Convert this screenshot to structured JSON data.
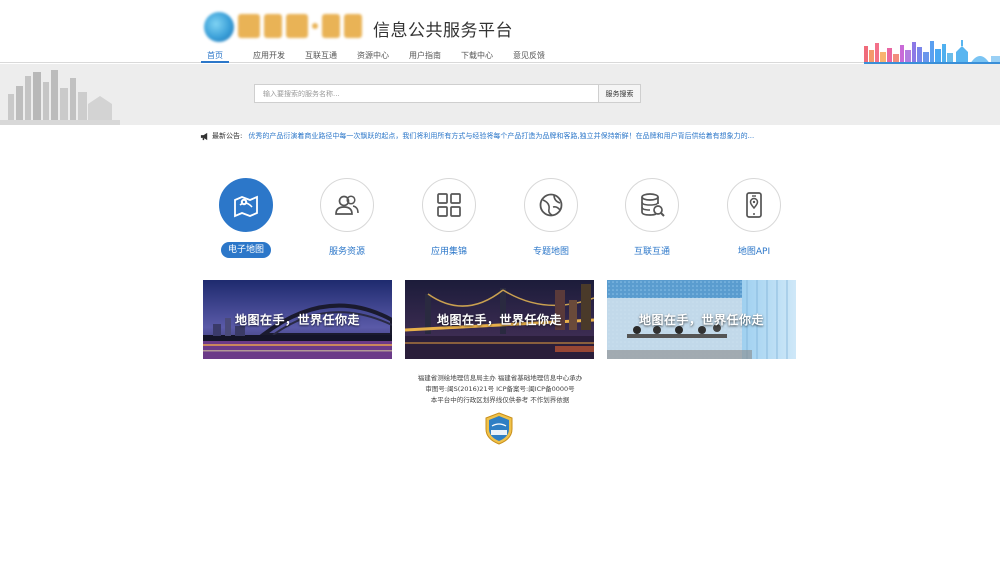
{
  "header": {
    "site_title": "信息公共服务平台",
    "nav": [
      {
        "label": "首页",
        "active": true
      },
      {
        "label": "应用开发",
        "active": false
      },
      {
        "label": "互联互通",
        "active": false
      },
      {
        "label": "资源中心",
        "active": false
      },
      {
        "label": "用户指南",
        "active": false
      },
      {
        "label": "下载中心",
        "active": false
      },
      {
        "label": "意见反馈",
        "active": false
      }
    ]
  },
  "search": {
    "placeholder": "输入要搜索的服务名称...",
    "button_label": "服务搜索"
  },
  "notice": {
    "label": "最新公告:",
    "text": "优秀的产品衍演着商业路径中每一次飘跃的起点，我们将利用所有方式与经验将每个产品打造为品牌和客路,独立并保持新鲜！在品牌和用户背后供给着有想象力的..."
  },
  "categories": [
    {
      "label": "电子地图",
      "icon": "map-icon",
      "active": true
    },
    {
      "label": "服务资源",
      "icon": "users-icon",
      "active": false
    },
    {
      "label": "应用集锦",
      "icon": "grid-icon",
      "active": false
    },
    {
      "label": "专题地图",
      "icon": "globe-icon",
      "active": false
    },
    {
      "label": "互联互通",
      "icon": "database-icon",
      "active": false
    },
    {
      "label": "地图API",
      "icon": "phone-location-icon",
      "active": false
    }
  ],
  "banners": [
    {
      "text": "地图在手，世界任你走"
    },
    {
      "text": "地图在手，世界任你走"
    },
    {
      "text": "地图在手，世界任你走"
    }
  ],
  "footer": {
    "line1": "福建省测绘地理信息局主办    福建省基础地理信息中心承办",
    "line2": "审图号:闽S(2016)21号    ICP备案号:闽ICP备0000号",
    "line3": "本平台中的行政区划界线仅供参考 不作划界依据"
  },
  "colors": {
    "accent": "#2c77c9",
    "band": "#ededed"
  }
}
